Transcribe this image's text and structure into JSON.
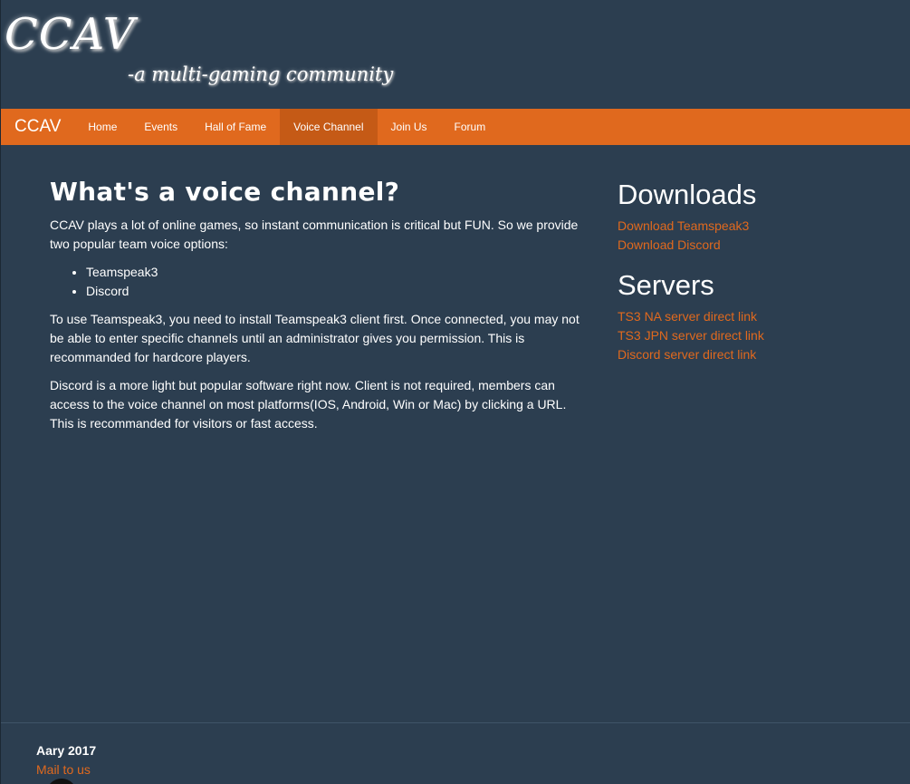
{
  "banner": {
    "title": "CCAV",
    "subtitle": "-a multi-gaming community"
  },
  "navbar": {
    "brand": "CCAV",
    "items": [
      {
        "label": "Home"
      },
      {
        "label": "Events"
      },
      {
        "label": "Hall of Fame"
      },
      {
        "label": "Voice Channel",
        "active": true
      },
      {
        "label": "Join Us"
      },
      {
        "label": "Forum"
      }
    ],
    "color": "#e0691e",
    "active_color": "#c55a16"
  },
  "main": {
    "heading": "What's a voice channel?",
    "intro": "CCAV plays a lot of online games, so instant communication is critical but FUN. So we provide two popular team voice options:",
    "options": [
      "Teamspeak3",
      "Discord"
    ],
    "teamspeak_paragraph": "To use Teamspeak3, you need to install Teamspeak3 client first. Once connected, you may not be able to enter specific channels until an administrator gives you permission. This is recommanded for hardcore players.",
    "discord_paragraph": "Discord is a more light but popular software right now. Client is not required, members can access to the voice channel on most platforms(IOS, Android, Win or Mac) by clicking a URL. This is recommanded for visitors or fast access."
  },
  "sidebar": {
    "downloads": {
      "heading": "Downloads",
      "links": [
        "Download Teamspeak3",
        "Download Discord"
      ]
    },
    "servers": {
      "heading": "Servers",
      "links": [
        "TS3 NA server direct link",
        "TS3 JPN server direct link",
        "Discord server direct link"
      ]
    },
    "link_color": "#e0691e"
  },
  "footer": {
    "date": "Aary 2017",
    "mail_label": "Mail to us"
  },
  "colors": {
    "background": "#2c3e50",
    "accent": "#e0691e"
  }
}
